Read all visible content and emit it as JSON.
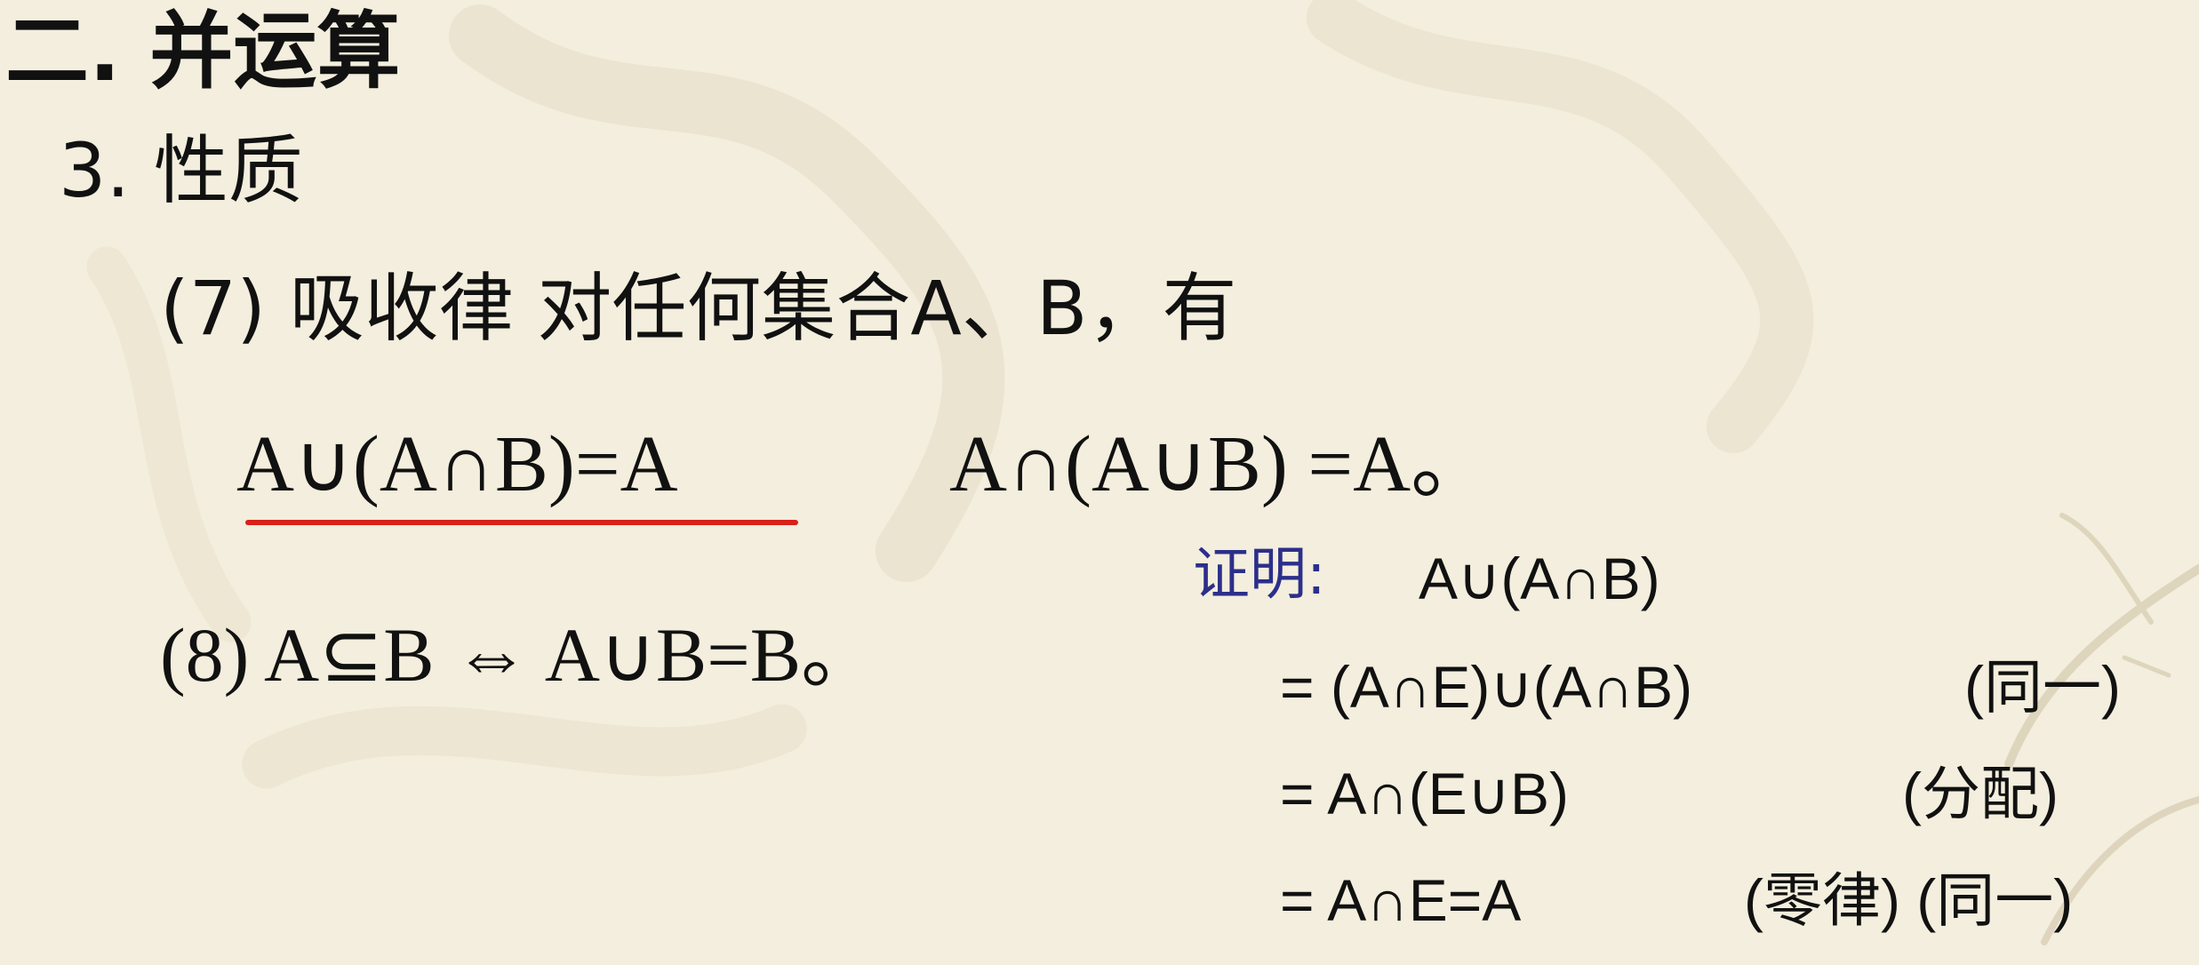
{
  "slide": {
    "heading": "二. 并运算",
    "subheading": "3. 性质",
    "item7": "(7) 吸收律 对任何集合A、B，有",
    "formula_left": "A∪(A∩B)=A",
    "formula_right": "A∩(A∪B) =A。",
    "item8": "(8) A⊆B ⇔ A∪B=B。",
    "proof": {
      "label": "证明:",
      "lines": [
        "A∪(A∩B)",
        "= (A∩E)∪(A∩B)",
        "= A∩(E∪B)",
        "= A∩E=A"
      ],
      "reasons": [
        "(同一)",
        "(分配)",
        "(零律) (同一)"
      ]
    }
  },
  "colors": {
    "background": "#f3eedd",
    "text": "#111111",
    "proof_label": "#2c2f8a",
    "underline": "#d9201a"
  }
}
